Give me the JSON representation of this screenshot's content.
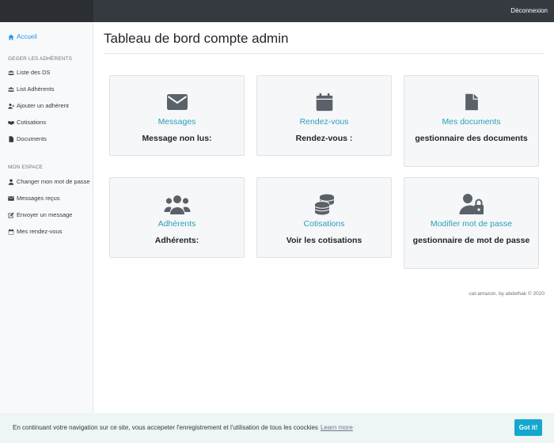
{
  "topbar": {
    "logout_label": "Déconnexion"
  },
  "sidebar": {
    "home_label": "Accueil",
    "section1_heading": "GEGER LES ADHÉRENTS",
    "section1_items": [
      {
        "label": "Liste des DS",
        "icon": "users-icon"
      },
      {
        "label": "List Adhérents",
        "icon": "users-icon"
      },
      {
        "label": "Ajouter un adhérent",
        "icon": "user-plus-icon"
      },
      {
        "label": "Cotisations",
        "icon": "handshake-icon"
      },
      {
        "label": "Documents",
        "icon": "file-icon"
      }
    ],
    "section2_heading": "MON ESPACE",
    "section2_items": [
      {
        "label": "Changer mon mot de passe",
        "icon": "user-icon"
      },
      {
        "label": "Messages reçus",
        "icon": "envelope-icon"
      },
      {
        "label": "Envoyer un message",
        "icon": "edit-icon"
      },
      {
        "label": "Mes rendez-vous",
        "icon": "calendar-icon"
      }
    ]
  },
  "main": {
    "page_title": "Tableau de bord compte admin",
    "cards": [
      {
        "title": "Messages",
        "text": "Message non lus:",
        "icon": "envelope-icon"
      },
      {
        "title": "Rendez-vous",
        "text": "Rendez-vous :",
        "icon": "calendar-icon"
      },
      {
        "title": "Mes documents",
        "text": "gestionnaire des documents",
        "icon": "file-icon"
      },
      {
        "title": "Adhérents",
        "text": "Adhérents:",
        "icon": "users-icon"
      },
      {
        "title": "Cotisations",
        "text": "Voir les cotisations",
        "icon": "coins-icon"
      },
      {
        "title": "Modifier mot de passe",
        "text": "gestionnaire de mot de passe",
        "icon": "user-lock-icon"
      }
    ],
    "footer_credit": "cat-amazon. by abdelhak © 2020"
  },
  "cookie_banner": {
    "message": "En continuant votre navigation sur ce site, vous accepeter l'enregistrement et l'utilisation de tous les coockies",
    "learn_more": "Learn more",
    "button_label": "Got it!"
  },
  "colors": {
    "topbar": "#343a40",
    "link_blue": "#2196f3",
    "card_title": "#2a9fbf",
    "card_icon": "#5a6169",
    "cookie_button": "#14a7d0"
  }
}
